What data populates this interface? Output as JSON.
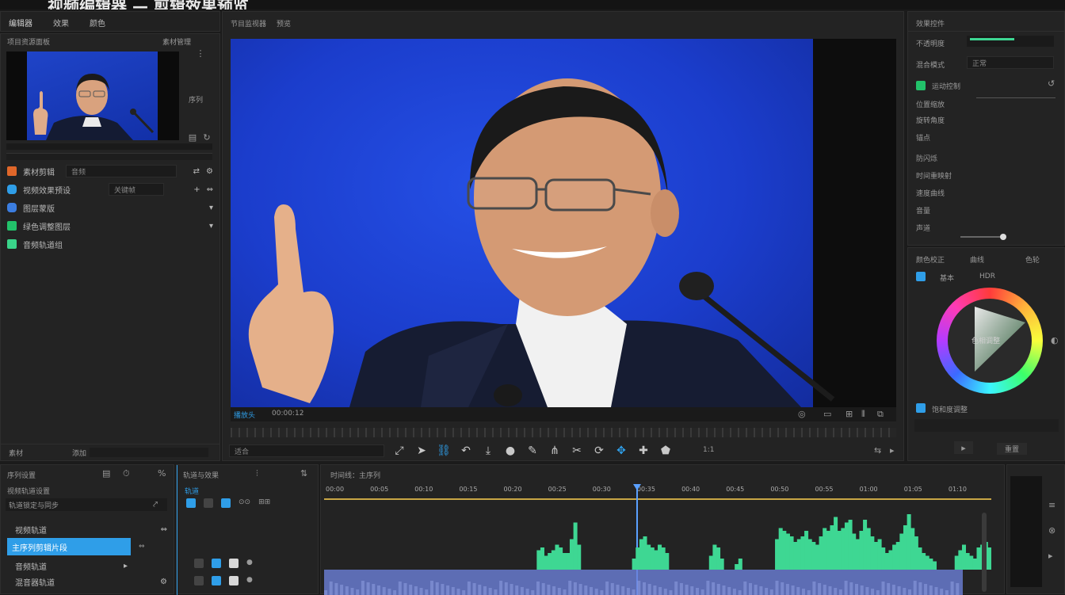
{
  "window": {
    "title": "视频编辑器 — 剪辑效果预览"
  },
  "top_tabs": [
    "编辑器",
    "效果",
    "颜色"
  ],
  "project": {
    "header": "项目资源面板",
    "header_right": "素材管理",
    "clip_side": "序列",
    "items": [
      {
        "label": "素材剪辑",
        "value": "音频",
        "color": "#e0672a"
      },
      {
        "label": "视频效果预设",
        "value": "关键帧",
        "color": "#2f9ee8"
      },
      {
        "label": "图层蒙版",
        "value": "",
        "color": "#3b7de0"
      },
      {
        "label": "绿色调整图层",
        "value": "",
        "color": "#22c26a"
      },
      {
        "label": "音频轨道组",
        "value": "",
        "color": "#3ad48a"
      }
    ],
    "footer": "素材",
    "footer_icon": "添加"
  },
  "program": {
    "header": "节目监视器",
    "header_right": "预览",
    "clip_label": "播放头",
    "timecode": "00:00:12"
  },
  "transport": {
    "zoom": "适合",
    "speed": "1:1"
  },
  "effects": {
    "header": "效果控件",
    "rows": [
      "不透明度",
      "混合模式",
      "运动控制",
      "位置缩放",
      "旋转角度",
      "锚点",
      "防闪烁",
      "时间重映射",
      "速度曲线",
      "音量",
      "声道"
    ],
    "blend_value": "正常"
  },
  "lumetri": {
    "tabs": [
      "颜色校正",
      "曲线",
      "色轮"
    ],
    "labels": [
      "基本",
      "HDR"
    ],
    "wheel_label": "色相调整",
    "bottom_label": "饱和度调整",
    "reset": "重置"
  },
  "sequence_panel": {
    "header": "序列设置",
    "rows": [
      "视频轨道设置",
      "轨道锁定与同步"
    ],
    "items": [
      "视频轨道",
      "主序列剪辑片段",
      "音频轨道",
      "混音器轨道"
    ],
    "selected": 1
  },
  "track_panel": {
    "header": "轨道与效果",
    "label": "轨道"
  },
  "timeline": {
    "header": "时间线：主序列",
    "ruler": [
      "00:00",
      "00:05",
      "00:10",
      "00:15",
      "00:20",
      "00:25",
      "00:30",
      "00:35",
      "00:40",
      "00:45",
      "00:50",
      "00:55",
      "01:00",
      "01:05",
      "01:10"
    ],
    "audio_levels": [
      0,
      0,
      0,
      0,
      0,
      0,
      0,
      0,
      0,
      0,
      0,
      0,
      0,
      0,
      0,
      0,
      0,
      0,
      0,
      0,
      0,
      0,
      0,
      0,
      0,
      0,
      0,
      0,
      0,
      0,
      0,
      0,
      0,
      0,
      0,
      0,
      0,
      0,
      0,
      0,
      0,
      0,
      0,
      0,
      0,
      0,
      0,
      0,
      0,
      0,
      0,
      0,
      0,
      0,
      0,
      0,
      0,
      0,
      0.35,
      0.4,
      0.25,
      0.3,
      0.35,
      0.45,
      0.4,
      0.3,
      0.3,
      0.55,
      0.85,
      0.45,
      0,
      0,
      0,
      0,
      0,
      0,
      0,
      0,
      0,
      0,
      0,
      0,
      0,
      0,
      0.2,
      0.4,
      0.55,
      0.6,
      0.45,
      0.4,
      0.35,
      0.45,
      0.4,
      0.3,
      0,
      0,
      0,
      0,
      0,
      0,
      0,
      0,
      0,
      0,
      0,
      0.25,
      0.45,
      0.4,
      0.2,
      0,
      0,
      0,
      0.1,
      0.2,
      0,
      0,
      0,
      0,
      0,
      0,
      0,
      0,
      0,
      0.55,
      0.75,
      0.7,
      0.65,
      0.6,
      0.5,
      0.55,
      0.6,
      0.7,
      0.55,
      0.5,
      0.45,
      0.6,
      0.75,
      0.7,
      0.8,
      0.95,
      0.7,
      0.75,
      0.85,
      0.9,
      0.65,
      0.55,
      0.7,
      0.9,
      0.75,
      0.6,
      0.5,
      0.55,
      0.4,
      0.3,
      0.35,
      0.45,
      0.5,
      0.65,
      0.8,
      1.0,
      0.75,
      0.6,
      0.4,
      0.3,
      0.25,
      0.2,
      0.15,
      0,
      0,
      0,
      0,
      0,
      0.25,
      0.35,
      0.45,
      0.3,
      0.25,
      0.2,
      0.4,
      0.45,
      0.5,
      0.4
    ]
  },
  "colors": {
    "accent": "#2f9ee8",
    "audio": "#3ed793",
    "video_track": "#6c7fd8",
    "ruler": "#c9a645"
  }
}
